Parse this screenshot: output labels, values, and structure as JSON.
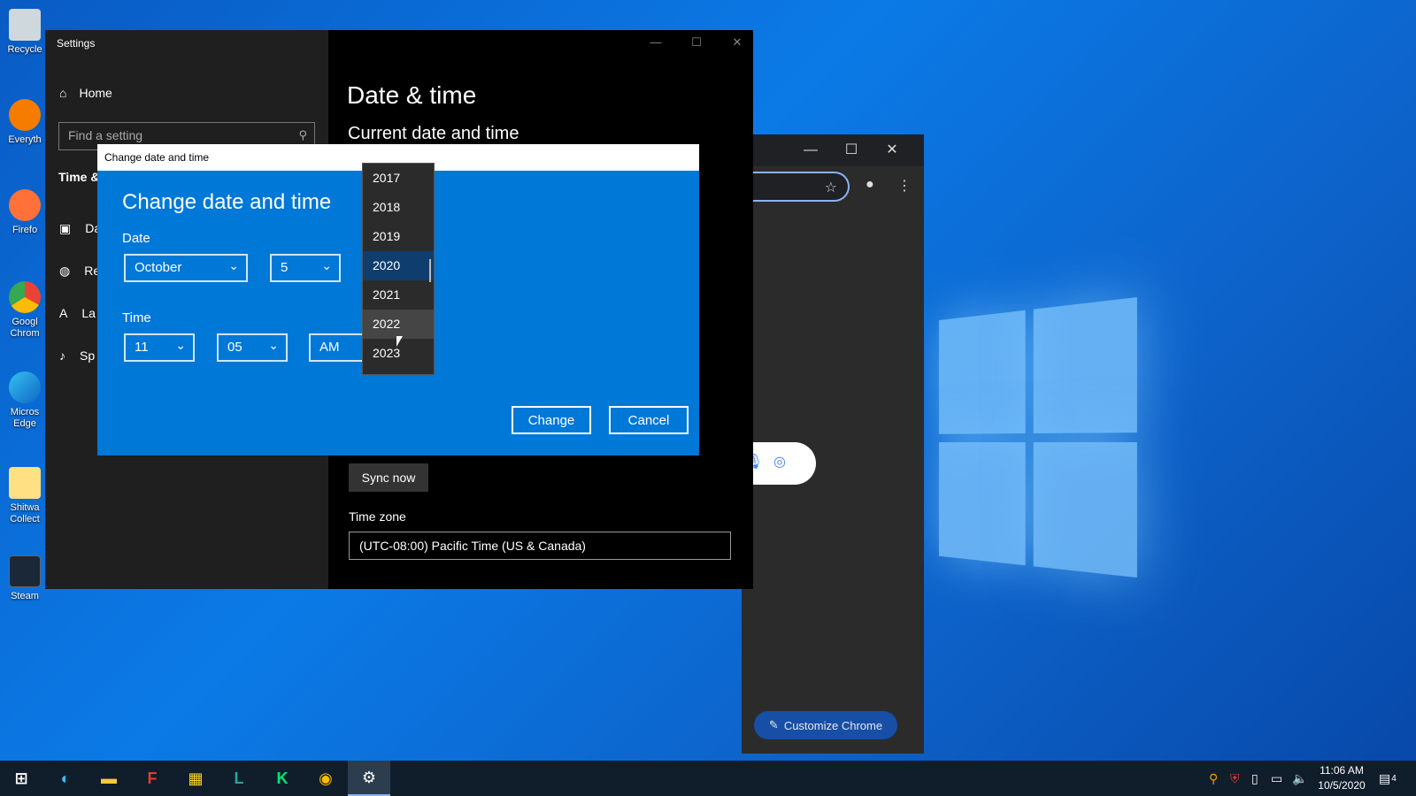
{
  "desktop": {
    "icons": [
      {
        "label": "Recycle",
        "icon": "recycle-bin-icon",
        "color": "#cfd8dc"
      },
      {
        "label": "Everyth",
        "icon": "everything-search-icon",
        "color": "#f57c00"
      },
      {
        "label": "Firefo",
        "icon": "firefox-icon",
        "color": "#ff7139"
      },
      {
        "label": "Googl Chrom",
        "icon": "chrome-icon",
        "color": "#4285f4"
      },
      {
        "label": "Micros Edge",
        "icon": "edge-icon",
        "color": "#1fa0d8"
      },
      {
        "label": "Shitwa Collect",
        "icon": "folder-icon",
        "color": "#ffd54f"
      },
      {
        "label": "Steam",
        "icon": "steam-icon",
        "color": "#1b2838"
      }
    ]
  },
  "chrome": {
    "minimize": "—",
    "maximize": "☐",
    "close": "✕",
    "customize_label": "Customize Chrome"
  },
  "settings": {
    "title": "Settings",
    "home_label": "Home",
    "search_placeholder": "Find a setting",
    "section": "Time &",
    "nav": [
      {
        "label": "Da",
        "icon": "calendar-clock-icon"
      },
      {
        "label": "Re",
        "icon": "globe-icon"
      },
      {
        "label": "La",
        "icon": "language-icon"
      },
      {
        "label": "Sp",
        "icon": "microphone-icon"
      }
    ],
    "page_title": "Date & time",
    "subheading": "Current date and time",
    "sync_label": "Sync now",
    "timezone_label": "Time zone",
    "timezone_value": "(UTC-08:00) Pacific Time (US & Canada)"
  },
  "dialog": {
    "titlebar": "Change date and time",
    "heading": "Change date and time",
    "date_label": "Date",
    "month": "October",
    "day": "5",
    "time_label": "Time",
    "hour": "11",
    "minute": "05",
    "ampm": "AM",
    "change_label": "Change",
    "cancel_label": "Cancel"
  },
  "year_dropdown": {
    "items": [
      "2017",
      "2018",
      "2019",
      "2020",
      "2021",
      "2022",
      "2023"
    ],
    "selected": "2020",
    "hovered": "2022"
  },
  "taskbar": {
    "time": "11:06 AM",
    "date": "10/5/2020",
    "notification_count": "4"
  }
}
